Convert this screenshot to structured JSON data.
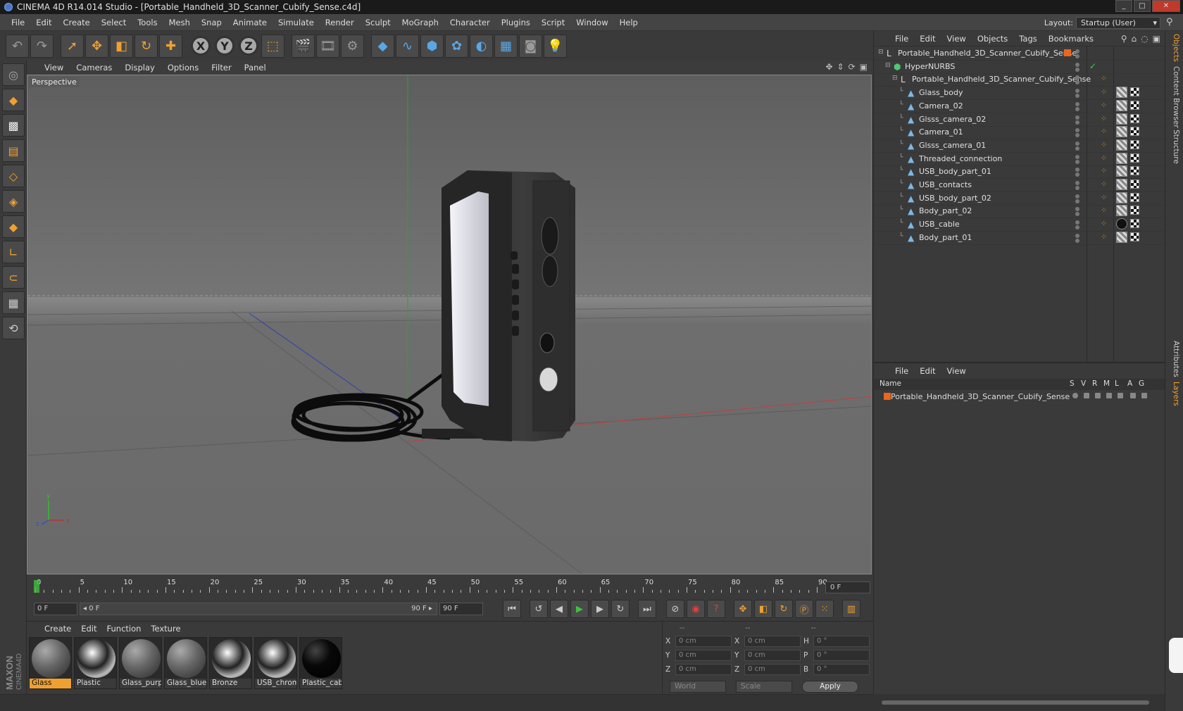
{
  "window": {
    "title": "CINEMA 4D R14.014 Studio - [Portable_Handheld_3D_Scanner_Cubify_Sense.c4d]",
    "controls": [
      "_",
      "□",
      "✕"
    ]
  },
  "menubar": {
    "items": [
      "File",
      "Edit",
      "Create",
      "Select",
      "Tools",
      "Mesh",
      "Snap",
      "Animate",
      "Simulate",
      "Render",
      "Sculpt",
      "MoGraph",
      "Character",
      "Plugins",
      "Script",
      "Window",
      "Help"
    ],
    "layout_label": "Layout:",
    "layout_value": "Startup (User)"
  },
  "viewport": {
    "menu": [
      "View",
      "Cameras",
      "Display",
      "Options",
      "Filter",
      "Panel"
    ],
    "label": "Perspective",
    "axis_labels": {
      "y": "y",
      "z": "z",
      "x": "x"
    }
  },
  "timeline": {
    "ticks": [
      "0",
      "5",
      "10",
      "15",
      "20",
      "25",
      "30",
      "35",
      "40",
      "45",
      "50",
      "55",
      "60",
      "65",
      "70",
      "75",
      "80",
      "85",
      "90"
    ],
    "frame_display": "0 F"
  },
  "transport": {
    "start_field": "0 F",
    "range_start": "◂ 0 F",
    "range_end": "90 F ▸",
    "end_field": "90 F"
  },
  "materials": {
    "menu": [
      "Create",
      "Edit",
      "Function",
      "Texture"
    ],
    "items": [
      {
        "label": "Glass",
        "style": "glass",
        "selected": true
      },
      {
        "label": "Plastic",
        "style": "chrome",
        "selected": false
      },
      {
        "label": "Glass_purp",
        "style": "glass",
        "selected": false
      },
      {
        "label": "Glass_blue",
        "style": "glass",
        "selected": false
      },
      {
        "label": "Bronze",
        "style": "chrome",
        "selected": false
      },
      {
        "label": "USB_chrom",
        "style": "chrome",
        "selected": false
      },
      {
        "label": "Plastic_cab",
        "style": "black",
        "selected": false
      }
    ]
  },
  "coordinates": {
    "headers": [
      "--",
      "--",
      "--"
    ],
    "rows": [
      {
        "a": "X",
        "av": "0 cm",
        "b": "X",
        "bv": "0 cm",
        "c": "H",
        "cv": "0 °"
      },
      {
        "a": "Y",
        "av": "0 cm",
        "b": "Y",
        "bv": "0 cm",
        "c": "P",
        "cv": "0 °"
      },
      {
        "a": "Z",
        "av": "0 cm",
        "b": "Z",
        "bv": "0 cm",
        "c": "B",
        "cv": "0 °"
      }
    ],
    "space": "World",
    "mode": "Scale",
    "apply": "Apply"
  },
  "objects": {
    "menu": [
      "File",
      "Edit",
      "View",
      "Objects",
      "Tags",
      "Bookmarks"
    ],
    "tree": [
      {
        "name": "Portable_Handheld_3D_Scanner_Cubify_Sense",
        "level": 0,
        "icon": "null"
      },
      {
        "name": "HyperNURBS",
        "level": 1,
        "icon": "nurbs"
      },
      {
        "name": "Portable_Handheld_3D_Scanner_Cubify_Sense",
        "level": 2,
        "icon": "null"
      },
      {
        "name": "Glass_body",
        "level": 3,
        "icon": "mesh",
        "tag": "mat1"
      },
      {
        "name": "Camera_02",
        "level": 3,
        "icon": "mesh",
        "tag": "mat1"
      },
      {
        "name": "Glsss_camera_02",
        "level": 3,
        "icon": "mesh",
        "tag": "mat1"
      },
      {
        "name": "Camera_01",
        "level": 3,
        "icon": "mesh",
        "tag": "mat1"
      },
      {
        "name": "Glsss_camera_01",
        "level": 3,
        "icon": "mesh",
        "tag": "mat1"
      },
      {
        "name": "Threaded_connection",
        "level": 3,
        "icon": "mesh",
        "tag": "mat1"
      },
      {
        "name": "USB_body_part_01",
        "level": 3,
        "icon": "mesh",
        "tag": "mat1"
      },
      {
        "name": "USB_contacts",
        "level": 3,
        "icon": "mesh",
        "tag": "mat1"
      },
      {
        "name": "USB_body_part_02",
        "level": 3,
        "icon": "mesh",
        "tag": "mat1"
      },
      {
        "name": "Body_part_02",
        "level": 3,
        "icon": "mesh",
        "tag": "mat1"
      },
      {
        "name": "USB_cable",
        "level": 3,
        "icon": "mesh",
        "tag": "blk"
      },
      {
        "name": "Body_part_01",
        "level": 3,
        "icon": "mesh",
        "tag": "mat1"
      }
    ]
  },
  "layers": {
    "menu": [
      "File",
      "Edit",
      "View"
    ],
    "columns": [
      "Name",
      "S",
      "V",
      "R",
      "M",
      "L",
      "A",
      "G"
    ],
    "rows": [
      {
        "name": "Portable_Handheld_3D_Scanner_Cubify_Sense"
      }
    ]
  },
  "sidetabs": [
    "Objects",
    "Content Browser",
    "Structure",
    "Attributes",
    "Layers"
  ],
  "colors": {
    "accent": "#f0a030",
    "selected_tab": "#f0a030",
    "layer_color": "#e86820"
  }
}
